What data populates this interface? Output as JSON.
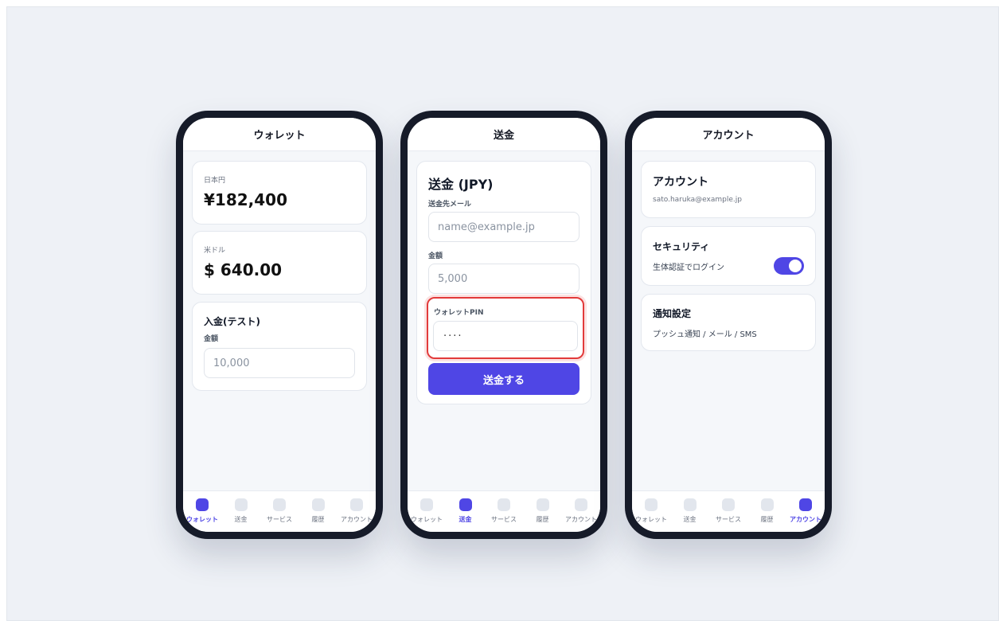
{
  "colors": {
    "accent": "#4f46e5",
    "highlight": "#e23a3a",
    "frame": "#161b29"
  },
  "nav": [
    "ウォレット",
    "送金",
    "サービス",
    "履歴",
    "アカウント"
  ],
  "wallet": {
    "title": "ウォレット",
    "jpy_label": "日本円",
    "jpy_value": "¥182,400",
    "usd_label": "米ドル",
    "usd_value": "$ 640.00",
    "deposit_title": "入金(テスト)",
    "amount_label": "金額",
    "amount_placeholder": "10,000"
  },
  "transfer": {
    "title": "送金",
    "form_title": "送金 (JPY)",
    "email_label": "送金先メール",
    "email_placeholder": "name@example.jp",
    "amount_label": "金額",
    "amount_value": "5,000",
    "pin_label": "ウォレットPIN",
    "pin_value": "····",
    "submit_label": "送金する"
  },
  "account": {
    "title": "アカウント",
    "heading": "アカウント",
    "email": "sato.haruka@example.jp",
    "security_title": "セキュリティ",
    "biometric_label": "生体認証でログイン",
    "biometric_on": true,
    "notify_title": "通知設定",
    "notify_value": "プッシュ通知 / メール / SMS"
  }
}
